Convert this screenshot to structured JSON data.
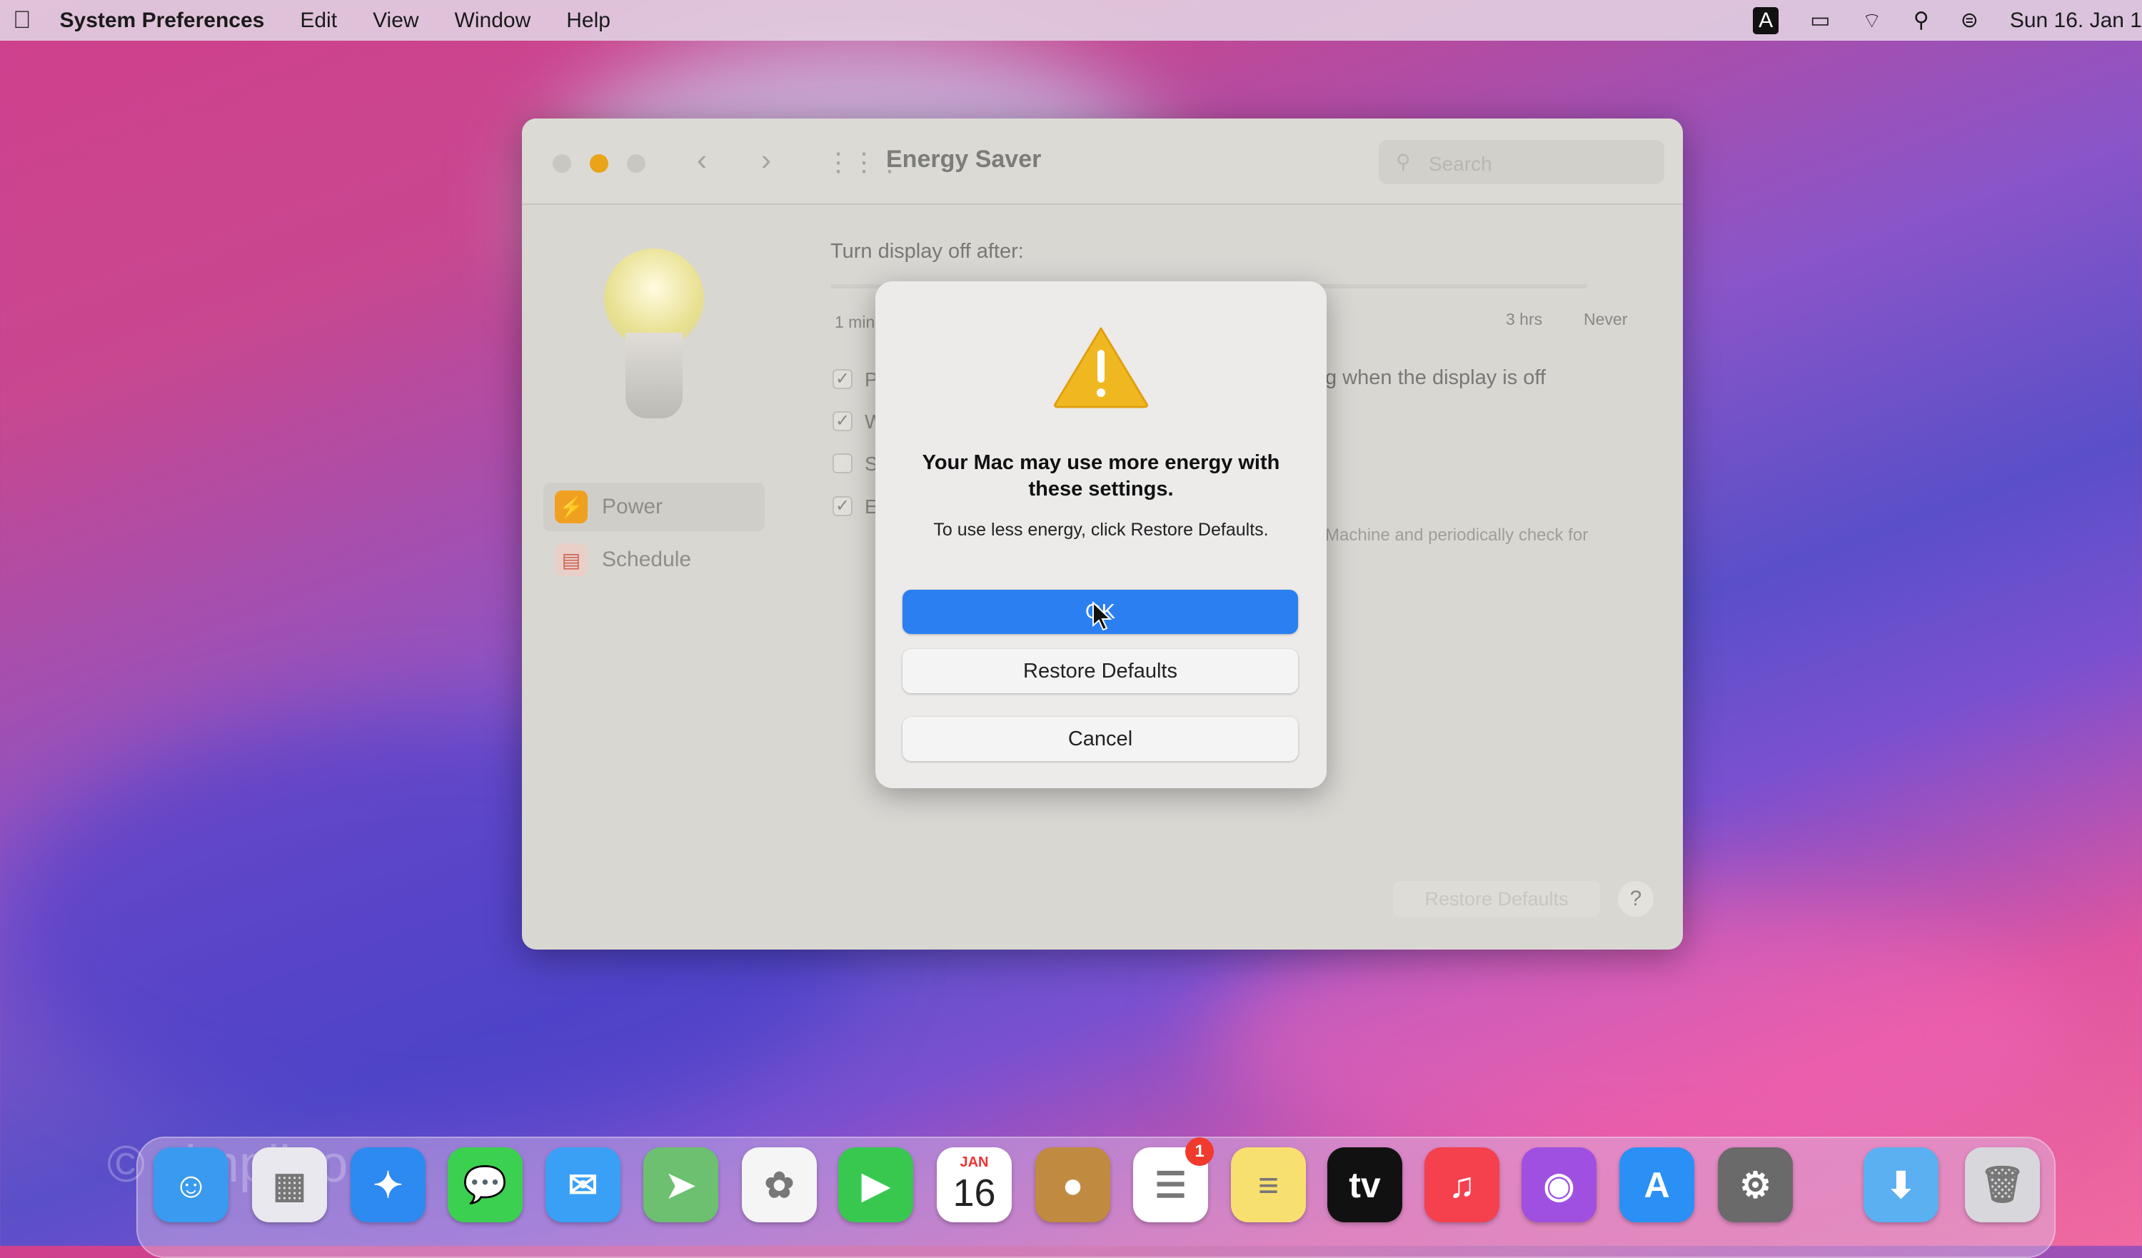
{
  "menubar": {
    "app": "System Preferences",
    "items": [
      "Edit",
      "View",
      "Window",
      "Help"
    ],
    "clock": "Sun 16. Jan 1",
    "input_indicator": "A"
  },
  "window": {
    "title": "Energy Saver",
    "search_placeholder": "Search",
    "sidebar": [
      {
        "label": "Power",
        "icon": "bolt-icon",
        "color": "#f0a020",
        "selected": true
      },
      {
        "label": "Schedule",
        "icon": "calendar-icon",
        "color": "#e06050",
        "selected": false
      }
    ],
    "display_off_label": "Turn display off after:",
    "slider_labels": {
      "min": "1 min",
      "hrs": "3 hrs",
      "never": "Never"
    },
    "checkboxes": [
      {
        "visible_text": "P",
        "checked": true
      },
      {
        "visible_text": "W",
        "checked": true
      },
      {
        "visible_text": "S",
        "checked": false
      },
      {
        "visible_text": "E",
        "checked": true
      }
    ],
    "right_fragments": [
      "g when the display is off",
      "Machine and periodically check for"
    ],
    "restore_defaults": "Restore Defaults",
    "help": "?"
  },
  "dialog": {
    "title": "Your Mac may use more energy with these settings.",
    "message": "To use less energy, click Restore Defaults.",
    "ok": "OK",
    "restore": "Restore Defaults",
    "cancel": "Cancel"
  },
  "dock": [
    {
      "name": "finder",
      "color": "#3a9af0",
      "glyph": "☺"
    },
    {
      "name": "launchpad",
      "color": "#e8e8ee",
      "glyph": "▦"
    },
    {
      "name": "safari",
      "color": "#2d8af0",
      "glyph": "✦"
    },
    {
      "name": "messages",
      "color": "#3cd050",
      "glyph": "💬"
    },
    {
      "name": "mail",
      "color": "#3aa0f5",
      "glyph": "✉"
    },
    {
      "name": "maps",
      "color": "#6cc070",
      "glyph": "➤"
    },
    {
      "name": "photos",
      "color": "#f5f5f5",
      "glyph": "✿"
    },
    {
      "name": "facetime",
      "color": "#38c850",
      "glyph": "▶"
    },
    {
      "name": "calendar",
      "color": "#ffffff",
      "month": "JAN",
      "day": "16"
    },
    {
      "name": "contacts",
      "color": "#c08a40",
      "glyph": "●"
    },
    {
      "name": "reminders",
      "color": "#ffffff",
      "glyph": "☰",
      "badge": "1"
    },
    {
      "name": "notes",
      "color": "#f8e070",
      "glyph": "≡"
    },
    {
      "name": "tv",
      "color": "#111111",
      "glyph": "tv"
    },
    {
      "name": "music",
      "color": "#f5404e",
      "glyph": "♫"
    },
    {
      "name": "podcasts",
      "color": "#a050e0",
      "glyph": "◉"
    },
    {
      "name": "app-store",
      "color": "#2a90f5",
      "glyph": "A"
    },
    {
      "name": "system-preferences",
      "color": "#6a6a6a",
      "glyph": "⚙"
    },
    {
      "name": "downloads",
      "color": "#5ab0f0",
      "glyph": "⬇"
    },
    {
      "name": "trash",
      "color": "#d8d8dc",
      "glyph": "🗑"
    }
  ],
  "watermark": "© simpligo"
}
